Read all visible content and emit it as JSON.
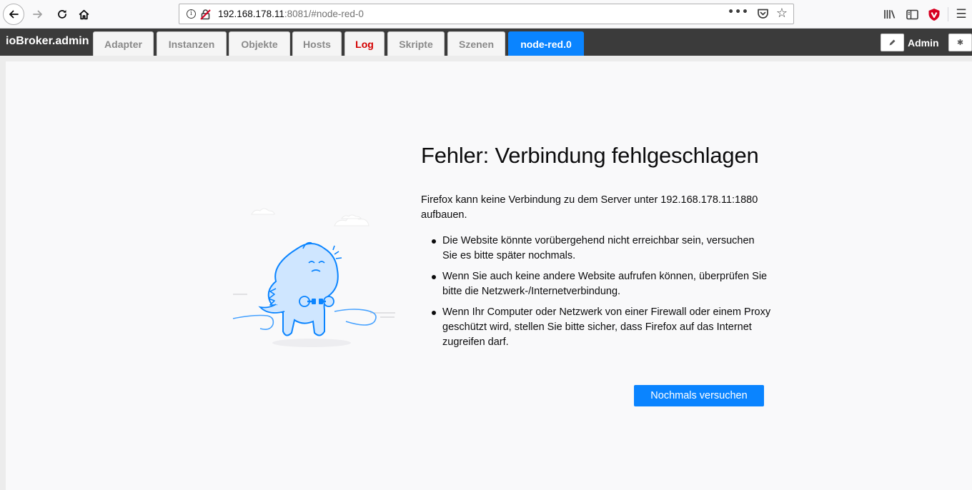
{
  "browser": {
    "url_host": "192.168.178.11",
    "url_rest": ":8081/#node-red-0",
    "page_actions_dots": "•••",
    "menu_glyph": "☰"
  },
  "iobroker": {
    "brand": "ioBroker.admin",
    "tabs": [
      {
        "label": "Adapter"
      },
      {
        "label": "Instanzen"
      },
      {
        "label": "Objekte"
      },
      {
        "label": "Hosts"
      },
      {
        "label": "Log",
        "color": "#d40000"
      },
      {
        "label": "Skripte"
      },
      {
        "label": "Szenen"
      },
      {
        "label": "node-red.0",
        "active": true,
        "color": "#0a84ff"
      }
    ],
    "user": "Admin"
  },
  "error_page": {
    "title": "Fehler: Verbindung fehlgeschlagen",
    "description": "Firefox kann keine Verbindung zu dem Server unter 192.168.178.11:1880 aufbauen.",
    "bullets": [
      "Die Website könnte vorübergehend nicht erreichbar sein, versuchen Sie es bitte später nochmals.",
      "Wenn Sie auch keine andere Website aufrufen können, überprüfen Sie bitte die Netzwerk-/Internetverbindung.",
      "Wenn Ihr Computer oder Netzwerk von einer Firewall oder einem Proxy geschützt wird, stellen Sie bitte sicher, dass Firefox auf das Internet zugreifen darf."
    ],
    "retry_button": "Nochmals versuchen"
  },
  "icons": {
    "back": "back-arrow-icon",
    "forward": "forward-arrow-icon",
    "reload": "reload-icon",
    "home": "home-icon",
    "info": "info-icon",
    "insecure": "insecure-lock-icon",
    "pocket": "pocket-icon",
    "bookmark": "star-icon",
    "library": "library-icon",
    "sidebar": "sidebar-icon",
    "shield": "shield-icon",
    "menu": "hamburger-menu-icon",
    "edit": "pencil-icon",
    "settings": "gear-icon"
  }
}
